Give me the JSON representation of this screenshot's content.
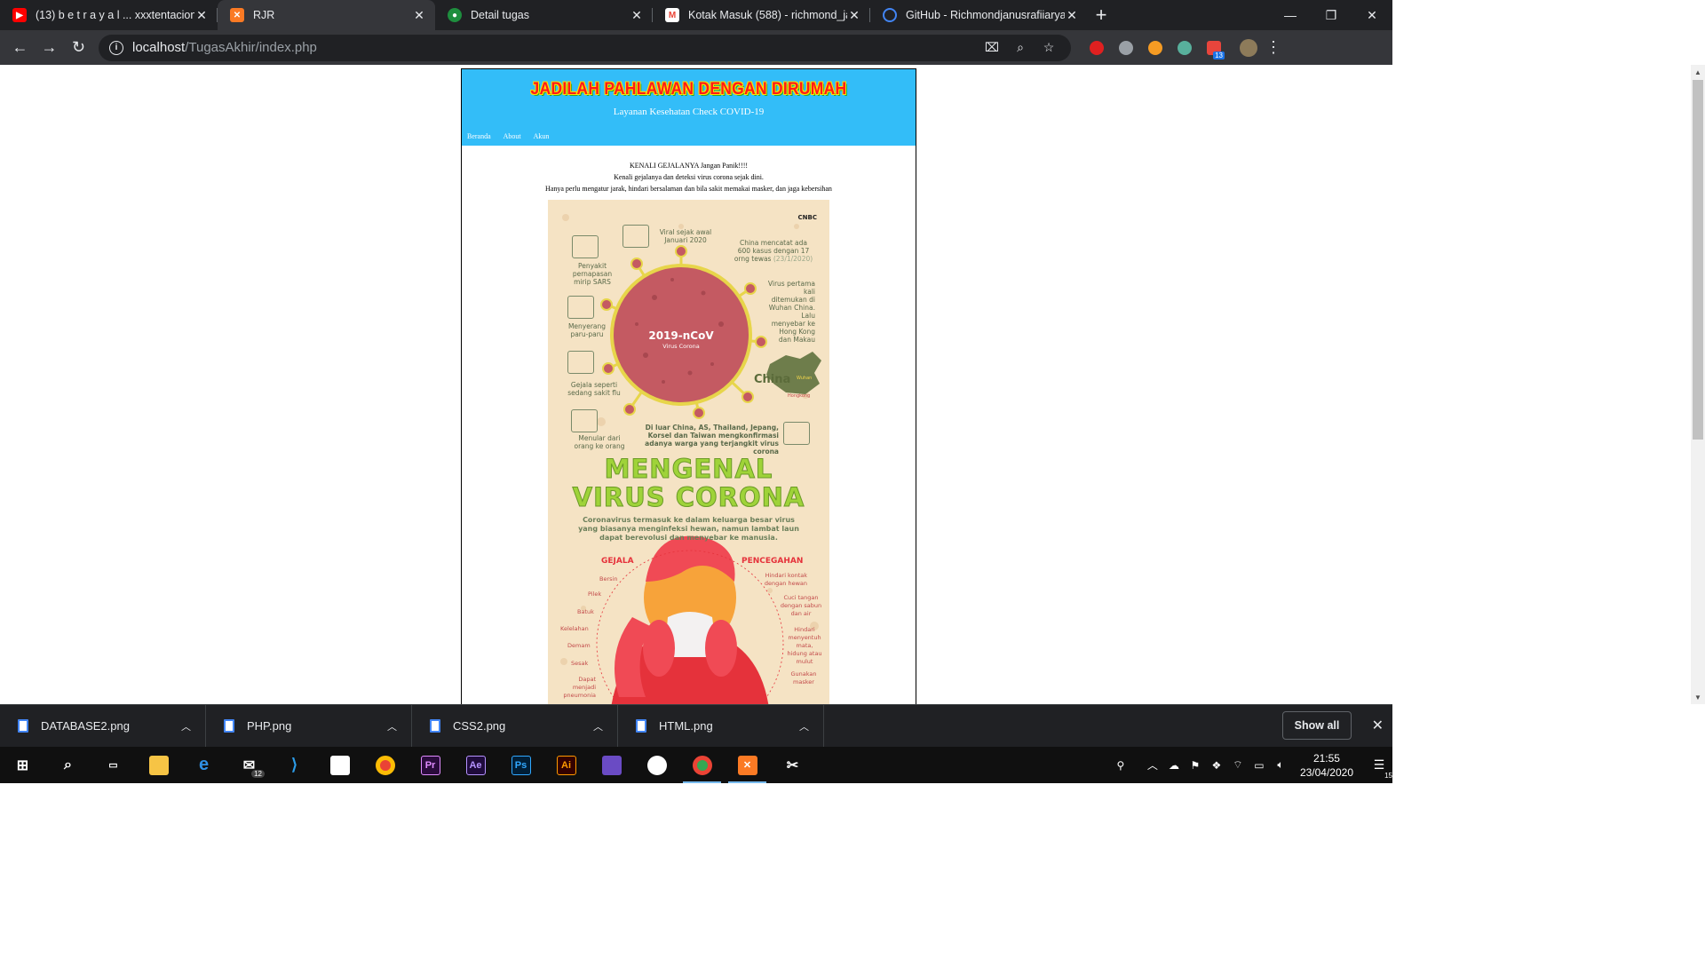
{
  "browser": {
    "tabs": [
      {
        "title": "(13) b e t r a y a l ... xxxtentacion",
        "favicon": "youtube-icon",
        "color": "#ff0000",
        "active": false
      },
      {
        "title": "RJR",
        "favicon": "xampp-icon",
        "color": "#fb7a24",
        "active": true
      },
      {
        "title": "Detail tugas",
        "favicon": "google-classroom-icon",
        "color": "#1e8e3e",
        "active": false
      },
      {
        "title": "Kotak Masuk (588) - richmond_ja",
        "favicon": "gmail-icon",
        "color": "#ea4335",
        "active": false
      },
      {
        "title": "GitHub - Richmondjanusrafiiaryar",
        "favicon": "github-icon",
        "color": "#4285f4",
        "active": false
      }
    ],
    "new_tab": "+",
    "window_controls": {
      "minimize": "—",
      "maximize": "❐",
      "close": "✕"
    },
    "address": {
      "host": "localhost",
      "path": "/TugasAkhir/index.php"
    },
    "extension_badge": "13"
  },
  "page": {
    "banner_title": "JADILAH PAHLAWAN DENGAN DIRUMAH",
    "subtitle": "Layanan Kesehatan Check COVID-19",
    "nav": [
      "Beranda",
      "About",
      "Akun"
    ],
    "lines": [
      "KENALI GEJALANYA Jangan Panik!!!!",
      "Kenali gejalanya dan deteksi virus corona sejak dini.",
      "Hanya perlu mengatur jarak, hindari bersalaman dan bila sakit memakai masker, dan jaga kebersihan"
    ],
    "poster": {
      "brand": "CNBC",
      "virus_label": "2019-nCoV",
      "virus_sub": "Virus Corona",
      "viral": "Viral sejak awal Januari 2020",
      "china_cases": "China mencatat ada 600 kasus dengan 17 orng tewas",
      "china_cases_date": "(23/1/2020)",
      "left_items": [
        "Penyakit pernapasan mirip SARS",
        "Menyerang paru-paru",
        "Gejala seperti sedang sakit flu",
        "Menular dari orang ke orang"
      ],
      "right_text": "Virus pertama kali ditemukan di Wuhan China. Lalu menyebar ke Hong Kong dan Makau",
      "map_label": "China",
      "map_wuhan": "Wuhan",
      "map_hk": "Hongkong",
      "outside": "Di luar China, AS, Thailand, Jepang, Korsel dan Taiwan mengkonfirmasi adanya warga yang terjangkit virus corona",
      "headline1": "MENGENAL",
      "headline2": "VIRUS CORONA",
      "description": "Coronavirus termasuk ke dalam keluarga besar virus yang biasanya menginfeksi hewan, namun lambat laun dapat berevolusi dan menyebar ke manusia.",
      "gejala_title": "GEJALA",
      "gejala": [
        "Bersin",
        "Pilek",
        "Batuk",
        "Kelelahan",
        "Demam",
        "Sesak",
        "Dapat menjadi pneumonia"
      ],
      "pencegahan_title": "PENCEGAHAN",
      "pencegahan": [
        "Hindari kontak dengan hewan",
        "Cuci tangan dengan sabun dan air",
        "Hindari menyentuh mata, hidung atau mulut",
        "Gunakan masker"
      ]
    }
  },
  "downloads": {
    "items": [
      "DATABASE2.png",
      "PHP.png",
      "CSS2.png",
      "HTML.png"
    ],
    "show_all": "Show all"
  },
  "taskbar": {
    "mail_badge": "12",
    "time": "21:55",
    "date": "23/04/2020",
    "notifications": "15"
  }
}
